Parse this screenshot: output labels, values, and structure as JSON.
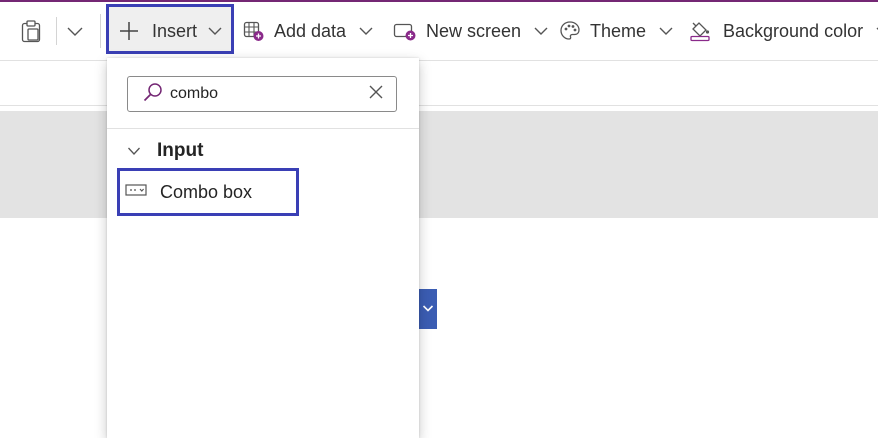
{
  "toolbar": {
    "insert_label": "Insert",
    "add_data_label": "Add data",
    "new_screen_label": "New screen",
    "theme_label": "Theme",
    "background_color_label": "Background color"
  },
  "insert_panel": {
    "search": {
      "value": "combo"
    },
    "groups": [
      {
        "label": "Input",
        "items": [
          {
            "label": "Combo box"
          }
        ]
      }
    ]
  },
  "icons": {
    "paste": "paste-icon",
    "insert": "plus-icon",
    "add_data": "table-add-icon",
    "new_screen": "screen-add-icon",
    "theme": "palette-icon",
    "background_color": "paint-bucket-icon",
    "search": "search-icon",
    "clear": "close-icon",
    "combo_box": "combo-box-icon"
  },
  "colors": {
    "accent": "#742774",
    "highlight_border": "#3a3fb5",
    "control_fill": "#3b5db3",
    "canvas_gray": "#e3e3e3"
  }
}
